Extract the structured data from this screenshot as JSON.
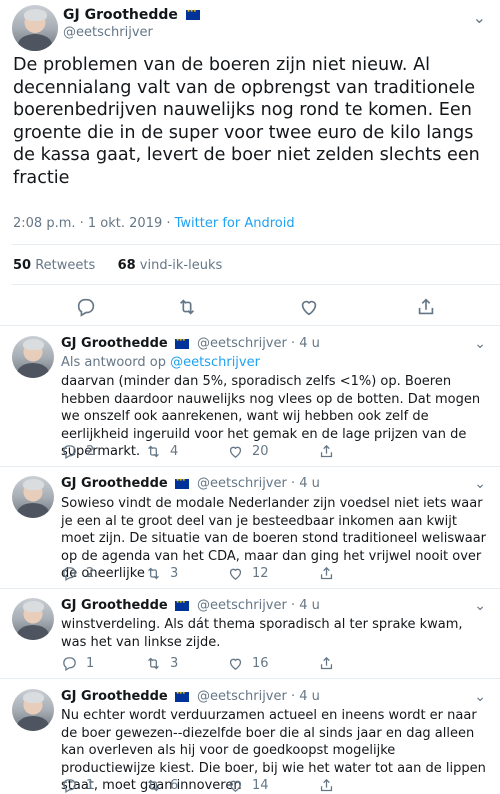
{
  "main": {
    "name": "GJ Groothedde",
    "handle": "@eetschrijver",
    "text": "De problemen van de boeren zijn niet nieuw. Al decennialang valt van de opbrengst van traditionele boerenbedrijven nauwelijks nog rond te komen. Een groente die in de super voor twee euro de kilo langs de kassa gaat, levert de boer niet zelden slechts een fractie",
    "time": "2:08 p.m. · 1 okt. 2019 · ",
    "via": "Twitter for Android",
    "retweets_count": "50",
    "retweets_label": "Retweets",
    "likes_count": "68",
    "likes_label": "vind-ik-leuks"
  },
  "icons": {
    "more": "chevron-down-icon",
    "reply": "reply-icon",
    "retweet": "retweet-icon",
    "like": "heart-icon",
    "share": "share-icon",
    "flag": "eu-flag-icon"
  },
  "colors": {
    "accent": "#1da1f2",
    "muted": "#657786",
    "text": "#14171a",
    "divider": "#e6ecf0"
  },
  "replies": [
    {
      "name": "GJ Groothedde",
      "handle": "@eetschrijver · 4 u",
      "reply_to_label": "Als antwoord op ",
      "reply_to_handle": "@eetschrijver",
      "text": "daarvan (minder dan 5%, sporadisch zelfs <1%) op.  Boeren hebben daardoor nauwelijks nog vlees op de botten. Dat mogen we onszelf ook aanrekenen, want wij hebben ook zelf de eerlijkheid ingeruild voor het gemak en de lage prijzen van de supermarkt.",
      "replies": "2",
      "retweets": "4",
      "likes": "20"
    },
    {
      "name": "GJ Groothedde",
      "handle": "@eetschrijver · 4 u",
      "text": "Sowieso vindt de modale Nederlander zijn voedsel niet iets waar je een al te groot deel van je besteedbaar inkomen aan kwijt moet zijn. De situatie van de boeren stond traditioneel weliswaar op de agenda van het CDA, maar dan ging het vrijwel nooit over de oneerlijke",
      "replies": "2",
      "retweets": "3",
      "likes": "12"
    },
    {
      "name": "GJ Groothedde",
      "handle": "@eetschrijver · 4 u",
      "text": "winstverdeling. Als dát thema sporadisch al ter sprake kwam, was het van linkse zijde.",
      "replies": "1",
      "retweets": "3",
      "likes": "16"
    },
    {
      "name": "GJ Groothedde",
      "handle": "@eetschrijver · 4 u",
      "text": "Nu echter wordt verduurzamen actueel en ineens wordt er naar de boer gewezen--diezelfde boer die al sinds jaar en dag alleen kan overleven als hij voor de goedkoopst mogelijke productiewijze kiest. Die boer, bij wie het water tot aan de lippen staat, moet gaan innoveren",
      "replies": "1",
      "retweets": "6",
      "likes": "14"
    }
  ]
}
